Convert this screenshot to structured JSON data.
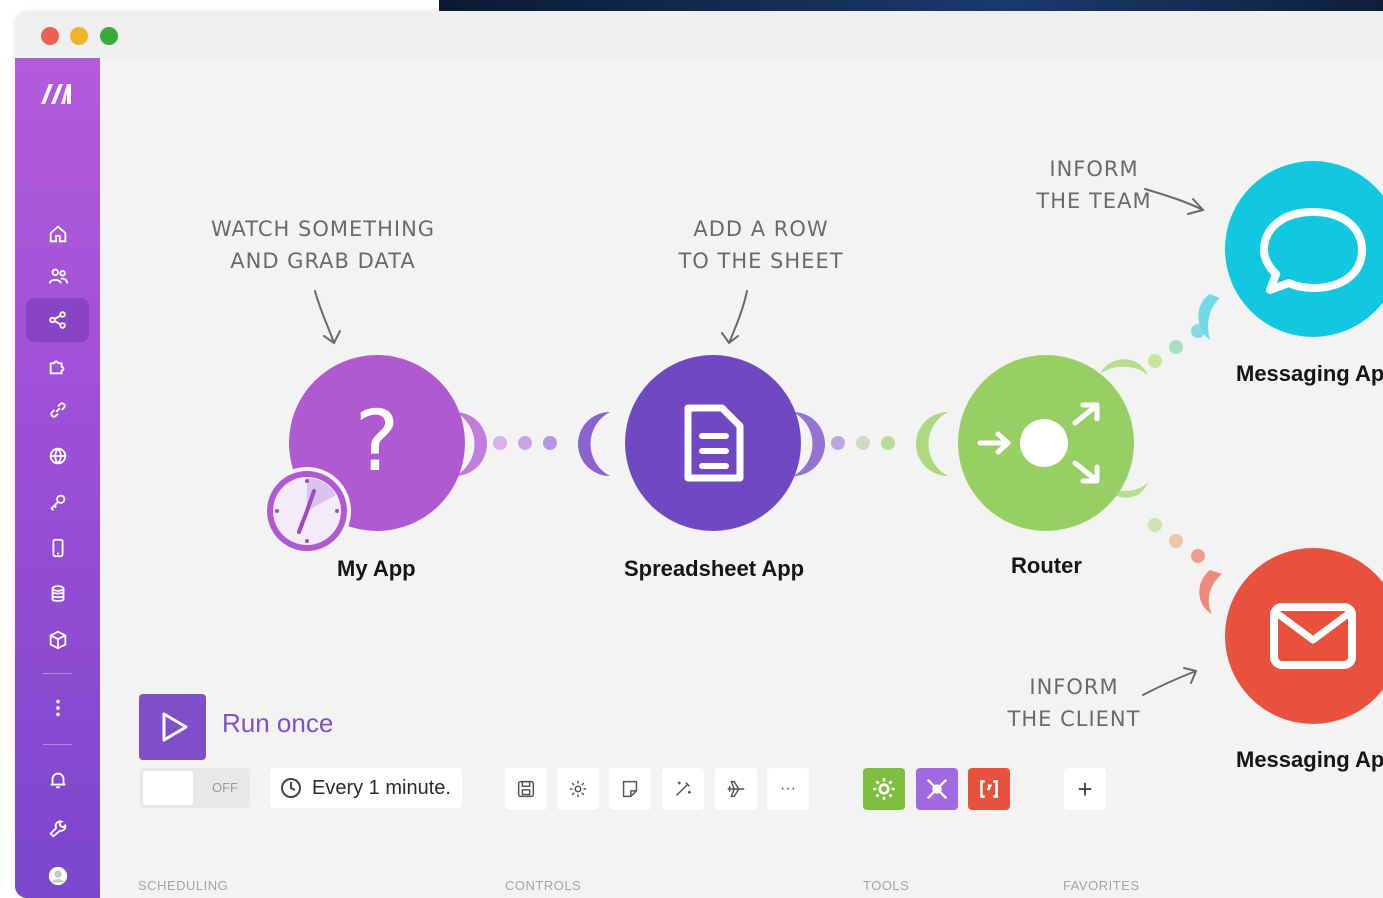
{
  "window": {
    "controls": [
      "close",
      "minimize",
      "zoom"
    ],
    "colors": {
      "close": "#ec5f53",
      "minimize": "#f0b429",
      "zoom": "#3aaa3a"
    }
  },
  "sidebar": {
    "logo": "make-logo",
    "items": [
      {
        "name": "home",
        "icon": "home-icon"
      },
      {
        "name": "team",
        "icon": "users-icon"
      },
      {
        "name": "scenarios",
        "icon": "share-nodes-icon",
        "active": true
      },
      {
        "name": "apps",
        "icon": "puzzle-icon"
      },
      {
        "name": "connections",
        "icon": "link-icon"
      },
      {
        "name": "webhooks",
        "icon": "globe-icon"
      },
      {
        "name": "keys",
        "icon": "key-icon"
      },
      {
        "name": "devices",
        "icon": "mobile-icon"
      },
      {
        "name": "data-stores",
        "icon": "database-icon"
      },
      {
        "name": "data-structures",
        "icon": "cube-icon"
      },
      {
        "name": "more",
        "icon": "more-vertical-icon"
      },
      {
        "name": "notifications",
        "icon": "bell-icon"
      },
      {
        "name": "settings",
        "icon": "wrench-icon"
      },
      {
        "name": "profile",
        "icon": "avatar-icon"
      }
    ]
  },
  "notes": {
    "watch": "WATCH SOMETHING\nAND GRAB DATA",
    "add_row": "ADD A ROW\nTO THE SHEET",
    "inform_team": "INFORM\nTHE TEAM",
    "inform_client": "INFORM\nTHE CLIENT"
  },
  "modules": {
    "my_app": {
      "label": "My App",
      "color": "#b05ad2",
      "icon": "question-mark-icon"
    },
    "spreadsheet": {
      "label": "Spreadsheet App",
      "color": "#7048c2",
      "icon": "document-icon"
    },
    "router": {
      "label": "Router",
      "color": "#98cf64",
      "icon": "router-icon"
    },
    "messaging_team": {
      "label": "Messaging App",
      "color": "#12c8e0",
      "icon": "chat-bubble-icon"
    },
    "messaging_client": {
      "label": "Messaging App",
      "color": "#e8513e",
      "icon": "envelope-icon"
    }
  },
  "toolbar": {
    "run_once": "Run once",
    "scheduling": {
      "toggle_state": "OFF",
      "schedule": "Every 1 minute.",
      "label": "SCHEDULING"
    },
    "controls": {
      "label": "CONTROLS",
      "icons": [
        "save-icon",
        "gear-icon",
        "note-icon",
        "magic-wand-icon",
        "airplane-icon",
        "more-icon"
      ],
      "more_label": "···"
    },
    "tools": {
      "label": "TOOLS",
      "items": [
        {
          "icon": "gear-tool-icon",
          "color": "#7dbe3f"
        },
        {
          "icon": "flow-control-icon",
          "color": "#a06ae0"
        },
        {
          "icon": "text-parser-icon",
          "color": "#e8513e"
        }
      ]
    },
    "favorites": {
      "label": "FAVORITES",
      "add": "+"
    }
  }
}
